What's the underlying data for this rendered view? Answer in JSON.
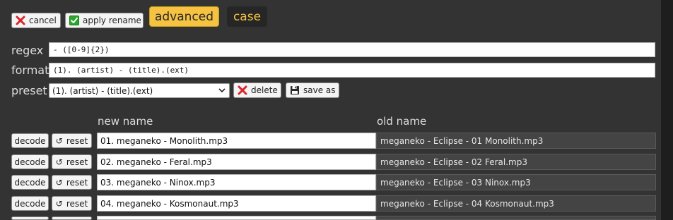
{
  "toolbar": {
    "cancel_label": "cancel",
    "apply_label": "apply rename",
    "tabs": [
      {
        "label": "advanced",
        "active": true
      },
      {
        "label": "case",
        "active": false
      }
    ]
  },
  "form": {
    "regex_label": "regex",
    "regex_value": "- ([0-9]{2})",
    "format_label": "format",
    "format_value": "(1). (artist) - (title).(ext)",
    "preset_label": "preset",
    "preset_selected": "(1). (artist) - (title).(ext)",
    "delete_label": "delete",
    "save_as_label": "save as"
  },
  "table": {
    "new_name_header": "new name",
    "old_name_header": "old name",
    "decode_label": "decode",
    "reset_label": "reset",
    "reset_glyph": "↺",
    "rows": [
      {
        "new_name": "01. meganeko - Monolith.mp3",
        "old_name": "meganeko - Eclipse - 01 Monolith.mp3"
      },
      {
        "new_name": "02. meganeko - Feral.mp3",
        "old_name": "meganeko - Eclipse - 02 Feral.mp3"
      },
      {
        "new_name": "03. meganeko - Ninox.mp3",
        "old_name": "meganeko - Eclipse - 03 Ninox.mp3"
      },
      {
        "new_name": "04. meganeko - Kosmonaut.mp3",
        "old_name": "meganeko - Eclipse - 04 Kosmonaut.mp3"
      },
      {
        "new_name": "",
        "old_name": ""
      }
    ]
  },
  "colors": {
    "background": "#333333",
    "accent": "#f5c242",
    "cancel_red": "#d9262e",
    "apply_green": "#29a829"
  },
  "icons": {
    "cancel": "x-icon",
    "apply": "checkbox-check-icon",
    "delete": "x-icon",
    "save": "floppy-disk-icon",
    "reset": "undo-arrow-icon",
    "preset_caret": "chevron-down-icon"
  }
}
